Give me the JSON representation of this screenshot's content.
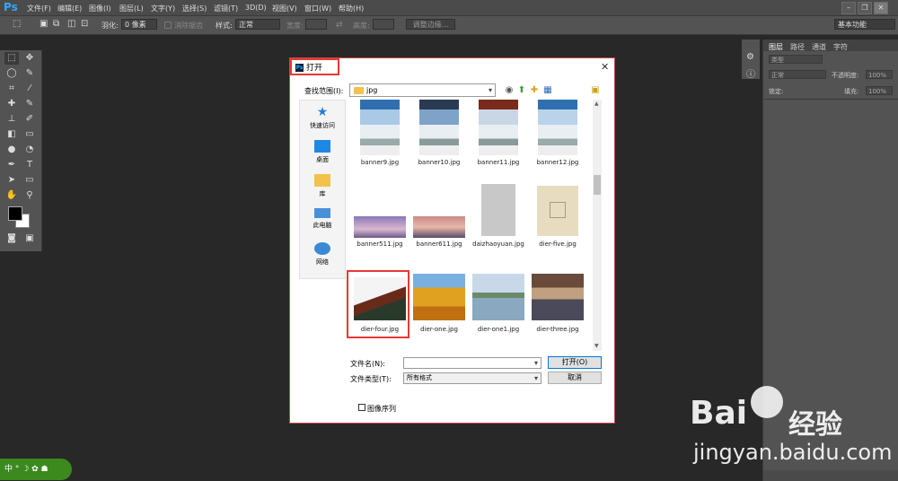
{
  "app": {
    "logo": "Ps"
  },
  "menu": [
    "文件(F)",
    "编辑(E)",
    "图像(I)",
    "图层(L)",
    "文字(Y)",
    "选择(S)",
    "滤镜(T)",
    "3D(D)",
    "视图(V)",
    "窗口(W)",
    "帮助(H)"
  ],
  "window_controls": {
    "minimize": "–",
    "restore": "❐",
    "close": "✕"
  },
  "options": {
    "feather_label": "羽化:",
    "feather_value": "0 像素",
    "antialias_label": "消除锯齿",
    "style_label": "样式:",
    "style_value": "正常",
    "width_label": "宽度:",
    "height_label": "高度:",
    "refine_edge": "调整边缘...",
    "workspace": "基本功能"
  },
  "layers_panel": {
    "tabs": [
      "图层",
      "路径",
      "通道",
      "字符"
    ],
    "kind": "类型",
    "blend": "正常",
    "opacity_label": "不透明度:",
    "opacity_value": "100%",
    "lock_label": "锁定:",
    "fill_label": "填充:",
    "fill_value": "100%"
  },
  "dialog": {
    "title": "打开",
    "close": "✕",
    "lookin_label": "查找范围(I):",
    "lookin_value": "jpg",
    "places": [
      "快速访问",
      "桌面",
      "库",
      "此电脑",
      "网络"
    ],
    "files": [
      {
        "name": "banner9.jpg"
      },
      {
        "name": "banner10.jpg"
      },
      {
        "name": "banner11.jpg"
      },
      {
        "name": "banner12.jpg"
      },
      {
        "name": "banner511.jpg"
      },
      {
        "name": "banner611.jpg"
      },
      {
        "name": "daizhaoyuan.jpg"
      },
      {
        "name": "dier-five.jpg"
      },
      {
        "name": "dier-four.jpg"
      },
      {
        "name": "dier-one.jpg"
      },
      {
        "name": "dier-one1.jpg"
      },
      {
        "name": "dier-three.jpg"
      }
    ],
    "filename_label": "文件名(N):",
    "filename_value": "",
    "filetype_label": "文件类型(T):",
    "filetype_value": "所有格式",
    "open_button": "打开(O)",
    "cancel_button": "取消",
    "image_sequence": "图像序列"
  },
  "watermark": {
    "bai": "Bai",
    "cn": "经验",
    "url": "jingyan.baidu.com"
  },
  "ime": {
    "text": "中 ° ☽ ✿ ☗"
  }
}
